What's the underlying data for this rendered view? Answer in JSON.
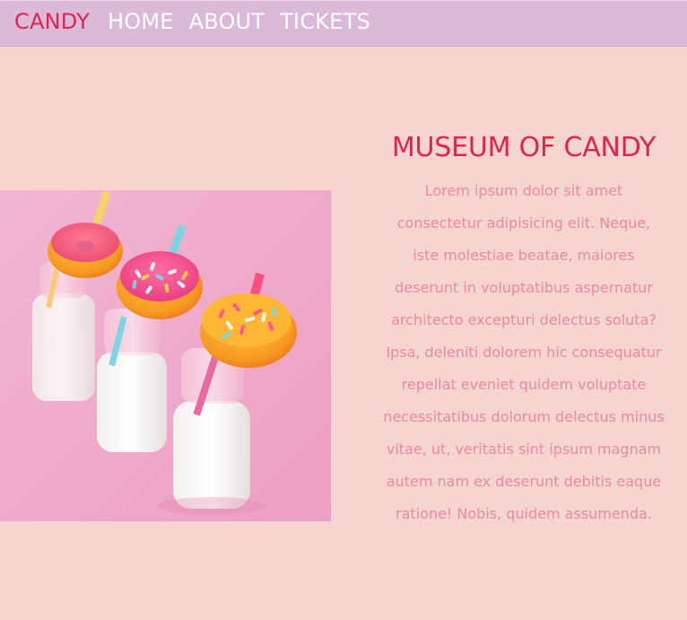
{
  "nav": {
    "brand": "CANDY",
    "links": [
      "HOME",
      "ABOUT",
      "TICKETS"
    ]
  },
  "hero": {
    "image_alt": "Milk bottles with sprinkle donuts and striped straws",
    "title": "MUSEUM OF CANDY",
    "body": "Lorem ipsum dolor sit amet consectetur adipisicing elit. Neque, iste molestiae beatae, maiores deserunt in voluptatibus aspernatur architecto excepturi delectus soluta? Ipsa, deleniti dolorem hic consequatur repellat eveniet quidem voluptate necessitatibus dolorum delectus minus vitae, ut, veritatis sint ipsum magnam autem nam ex deserunt debitis eaque ratione! Nobis, quidem assumenda."
  },
  "colors": {
    "background": "#f6d4cf",
    "navbar": "#dbb9d9",
    "accent": "#e0234f",
    "body_text": "#e88ba5"
  }
}
